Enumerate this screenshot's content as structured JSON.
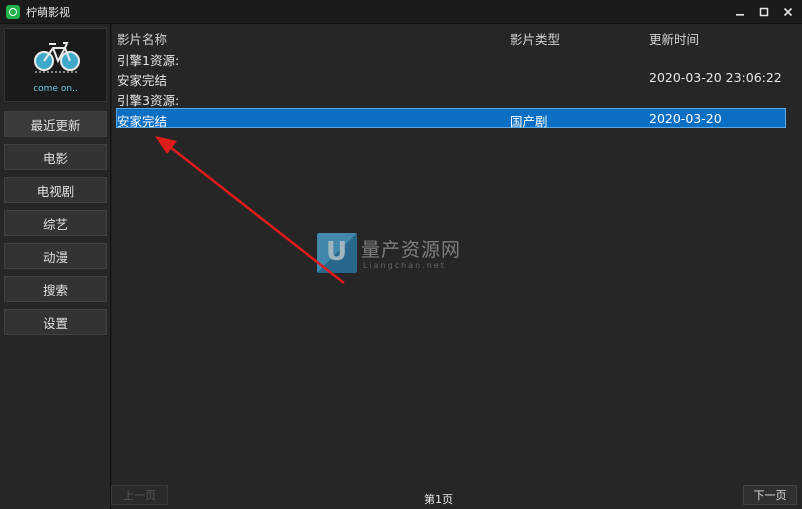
{
  "window": {
    "title": "柠萌影视",
    "icon": "app-logo-icon",
    "controls": [
      "minimize-icon",
      "maximize-icon",
      "close-icon"
    ]
  },
  "sidebar": {
    "logo_caption": "come on..",
    "items": [
      {
        "label": "最近更新",
        "active": true
      },
      {
        "label": "电影",
        "active": false
      },
      {
        "label": "电视剧",
        "active": false
      },
      {
        "label": "综艺",
        "active": false
      },
      {
        "label": "动漫",
        "active": false
      },
      {
        "label": "搜索",
        "active": false
      },
      {
        "label": "设置",
        "active": false
      }
    ]
  },
  "table": {
    "columns": [
      "影片名称",
      "影片类型",
      "更新时间"
    ],
    "rows": [
      {
        "name": "引擎1资源:",
        "type": "",
        "time": "",
        "selected": false
      },
      {
        "name": "安家完结",
        "type": "",
        "time": "2020-03-20 23:06:22",
        "selected": false
      },
      {
        "name": "引擎3资源:",
        "type": "",
        "time": "",
        "selected": false
      },
      {
        "name": "安家完结",
        "type": "国产剧",
        "time": "2020-03-20",
        "selected": true
      }
    ]
  },
  "watermark": {
    "text": "量产资源网",
    "sub": "Liangchan.net"
  },
  "pagination": {
    "prev_label": "上一页",
    "page_label": "第1页",
    "next_label": "下一页"
  },
  "colors": {
    "selection": "#0a6fc2",
    "annotation_arrow": "#e01b1b"
  }
}
